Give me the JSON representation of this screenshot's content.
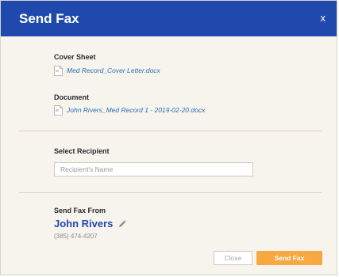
{
  "dialog": {
    "title": "Send Fax",
    "close_icon_label": "x"
  },
  "cover_sheet": {
    "label": "Cover Sheet",
    "file_name": "Med Record_Cover Letter.docx",
    "icon": "word-document-icon"
  },
  "document": {
    "label": "Document",
    "file_name": "John Rivers_Med Record 1 - 2019-02-20.docx",
    "icon": "word-document-icon"
  },
  "recipient": {
    "label": "Select Recipient",
    "input_value": "",
    "placeholder": "Recipient's Name"
  },
  "sender": {
    "label": "Send Fax From",
    "name": "John Rivers",
    "phone": "(385) 474-4207",
    "edit_icon": "pencil-icon"
  },
  "actions": {
    "close_label": "Close",
    "send_label": "Send Fax"
  },
  "colors": {
    "header_bg": "#1f49ad",
    "background": "#f7f4ee",
    "link": "#2a6db5",
    "accent": "#f7a840"
  }
}
